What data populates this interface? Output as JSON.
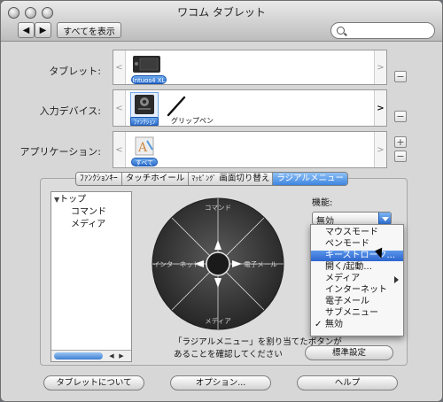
{
  "window": {
    "title": "ワコム タブレット",
    "show_all": "すべてを表示",
    "search_placeholder": ""
  },
  "rows": {
    "tablet": {
      "label": "タブレット:",
      "item_badge": "Intuos4 XL"
    },
    "input": {
      "label": "入力デバイス:",
      "function_badge": "ﾌｧﾝｸｼｮﾝ",
      "pen_label": "グリップペン"
    },
    "app": {
      "label": "アプリケーション:",
      "all_badge": "すべて"
    }
  },
  "tabs": [
    "ﾌｧﾝｸｼｮﾝｷｰ",
    "タッチホイール",
    "ﾏｯﾋﾟﾝｸﾞ",
    "画面切り替え",
    "ラジアルメニュー"
  ],
  "active_tab": 4,
  "tree": {
    "root": "トップ",
    "children": [
      "コマンド",
      "メディア"
    ]
  },
  "wheel": {
    "top": "コマンド",
    "left": "インターネット",
    "right": "電子メール",
    "bottom": "メディア"
  },
  "description": {
    "line1": "「ラジアルメニュー」を割り当てたボタンが",
    "line2": "あることを確認してください"
  },
  "function": {
    "label": "機能:",
    "selected": "無効"
  },
  "menu_items": [
    "マウスモード",
    "ペンモード",
    "キーストローク...",
    "開く/起動...",
    "メディア",
    "インターネット",
    "電子メール",
    "サブメニュー",
    "無効"
  ],
  "menu_highlight": 2,
  "defaults_button": "標準設定",
  "bottom_buttons": {
    "about": "タブレットについて",
    "options": "オプション...",
    "help": "ヘルプ"
  },
  "colors": {
    "accent": "#3d86e0"
  }
}
